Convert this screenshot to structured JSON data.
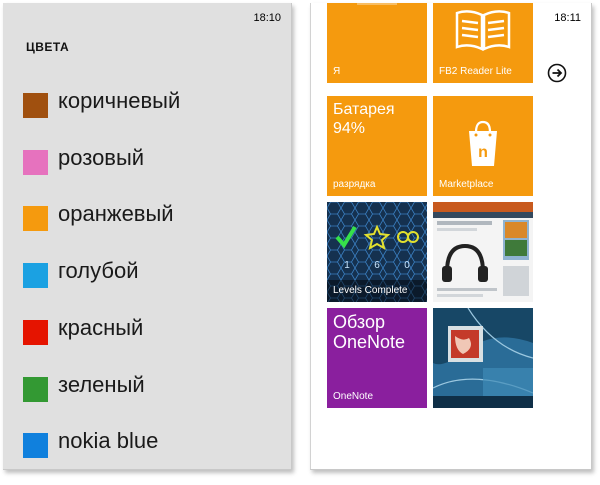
{
  "left": {
    "status_time": "18:10",
    "title": "ЦВЕТА",
    "colors": [
      {
        "label": "коричневый",
        "hex": "#a0500f"
      },
      {
        "label": "розовый",
        "hex": "#e672be"
      },
      {
        "label": "оранжевый",
        "hex": "#f59a0e"
      },
      {
        "label": "голубой",
        "hex": "#1ba1e2"
      },
      {
        "label": "красный",
        "hex": "#e51400"
      },
      {
        "label": "зеленый",
        "hex": "#339933"
      },
      {
        "label": "nokia blue",
        "hex": "#1080dd"
      }
    ]
  },
  "right": {
    "status_time": "18:11",
    "accent": "#f59a0e",
    "tiles": [
      {
        "id": "ya",
        "label": "Я",
        "big": "",
        "color": "#f59a0e"
      },
      {
        "id": "fb2",
        "label": "FB2 Reader Lite",
        "big": "",
        "color": "#f59a0e",
        "icon": "book-icon"
      },
      {
        "id": "battery",
        "label": "разрядка",
        "big": "Батарея\n94%",
        "color": "#f59a0e"
      },
      {
        "id": "marketplace",
        "label": "Marketplace",
        "big": "",
        "color": "#f59a0e",
        "icon": "shopping-bag-icon"
      },
      {
        "id": "levels",
        "label": "Levels Complete",
        "big": "",
        "color": "#1d3f66",
        "icon": "levels-game-icon"
      },
      {
        "id": "browser",
        "label": "",
        "big": "",
        "color": "#cfd6dc",
        "icon": "web-page-thumbnail"
      },
      {
        "id": "onenote",
        "label": "OneNote",
        "big": "Обзор\nOneNote",
        "color": "#8a1f9e"
      },
      {
        "id": "photo",
        "label": "",
        "big": "",
        "color": "#1f5b85",
        "icon": "photo-thumbnail"
      }
    ],
    "arrow_icon": "arrow-right-circle-icon"
  }
}
